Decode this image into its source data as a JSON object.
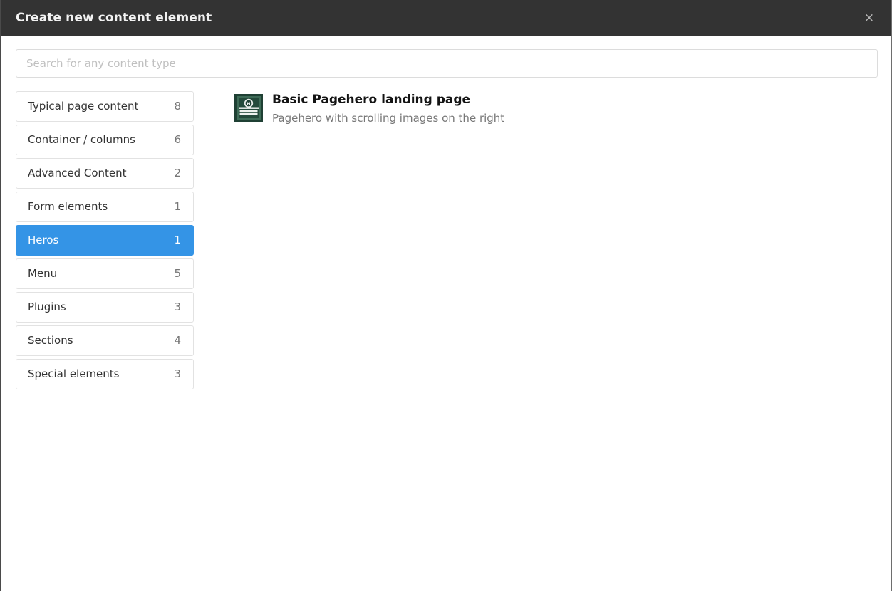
{
  "dialog": {
    "title": "Create new content element",
    "close_label": "×",
    "close_icon": "close-icon"
  },
  "search": {
    "placeholder": "Search for any content type",
    "value": ""
  },
  "categories": [
    {
      "label": "Typical page content",
      "count": "8",
      "active": false
    },
    {
      "label": "Container / columns",
      "count": "6",
      "active": false
    },
    {
      "label": "Advanced Content",
      "count": "2",
      "active": false
    },
    {
      "label": "Form elements",
      "count": "1",
      "active": false
    },
    {
      "label": "Heros",
      "count": "1",
      "active": true
    },
    {
      "label": "Menu",
      "count": "5",
      "active": false
    },
    {
      "label": "Plugins",
      "count": "3",
      "active": false
    },
    {
      "label": "Sections",
      "count": "4",
      "active": false
    },
    {
      "label": "Special elements",
      "count": "3",
      "active": false
    }
  ],
  "results": [
    {
      "title": "Basic Pagehero landing page",
      "description": "Pagehero with scrolling images on the right",
      "icon": "pagehero-landing-page-icon"
    }
  ],
  "colors": {
    "header_bg": "#333333",
    "accent": "#3494e6",
    "icon_frame": "#1f4034",
    "icon_inner": "#3e6b57",
    "text_primary": "#333333",
    "text_muted": "#777777"
  }
}
